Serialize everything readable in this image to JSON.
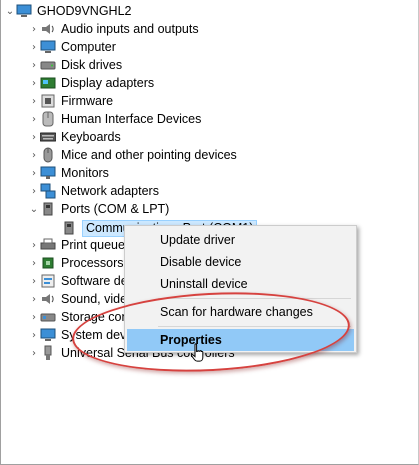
{
  "tree": {
    "root": "GHOD9VNGHL2",
    "categories": [
      {
        "label": "Audio inputs and outputs",
        "icon": "speaker-icon"
      },
      {
        "label": "Computer",
        "icon": "computer-icon"
      },
      {
        "label": "Disk drives",
        "icon": "disk-drive-icon"
      },
      {
        "label": "Display adapters",
        "icon": "display-adapter-icon"
      },
      {
        "label": "Firmware",
        "icon": "firmware-icon"
      },
      {
        "label": "Human Interface Devices",
        "icon": "hid-icon"
      },
      {
        "label": "Keyboards",
        "icon": "keyboard-icon"
      },
      {
        "label": "Mice and other pointing devices",
        "icon": "mouse-icon"
      },
      {
        "label": "Monitors",
        "icon": "monitor-icon"
      },
      {
        "label": "Network adapters",
        "icon": "network-icon"
      },
      {
        "label": "Ports (COM & LPT)",
        "icon": "port-icon"
      },
      {
        "label": "Communications Port (COM1)",
        "icon": "port-icon"
      },
      {
        "label": "Print queues",
        "icon": "printer-icon"
      },
      {
        "label": "Processors",
        "icon": "processor-icon"
      },
      {
        "label": "Software devices",
        "icon": "software-device-icon"
      },
      {
        "label": "Sound, video and game controllers",
        "icon": "sound-icon"
      },
      {
        "label": "Storage controllers",
        "icon": "storage-icon"
      },
      {
        "label": "System devices",
        "icon": "system-device-icon"
      },
      {
        "label": "Universal Serial Bus controllers",
        "icon": "usb-icon"
      }
    ]
  },
  "context_menu": {
    "items": [
      "Update driver",
      "Disable device",
      "Uninstall device",
      "Scan for hardware changes",
      "Properties"
    ],
    "highlighted": "Properties"
  },
  "colors": {
    "selection_bg": "#cce8ff",
    "menu_highlight": "#91c9f7",
    "annotation_oval": "#d6423f"
  }
}
